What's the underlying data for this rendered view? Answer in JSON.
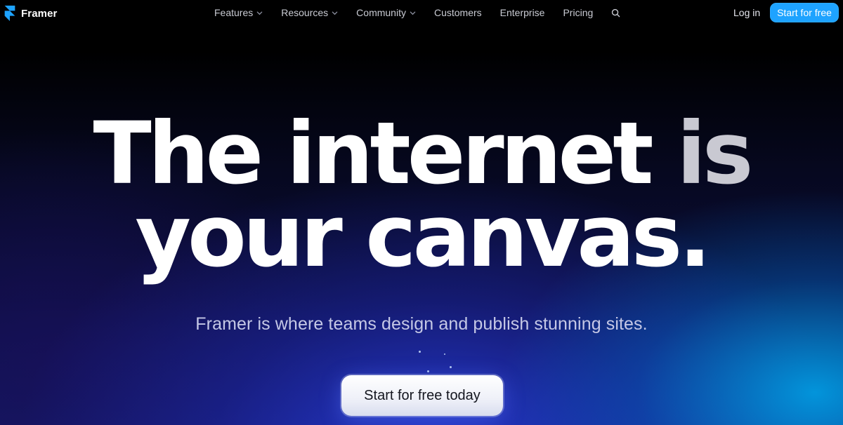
{
  "brand": {
    "name": "Framer",
    "logo_icon": "framer-logo-icon",
    "logo_color": "#1ea3ff"
  },
  "nav": {
    "items": [
      {
        "label": "Features",
        "has_dropdown": true
      },
      {
        "label": "Resources",
        "has_dropdown": true
      },
      {
        "label": "Community",
        "has_dropdown": true
      },
      {
        "label": "Customers",
        "has_dropdown": false
      },
      {
        "label": "Enterprise",
        "has_dropdown": false
      },
      {
        "label": "Pricing",
        "has_dropdown": false
      }
    ],
    "search_icon": "search-icon",
    "login_label": "Log in",
    "start_label": "Start for free",
    "start_color": "#1ea3ff"
  },
  "hero": {
    "title_line1": "The internet is",
    "title_line2": "your canvas.",
    "subtitle": "Framer is where teams design and publish stunning sites.",
    "cta_label": "Start for free today"
  }
}
